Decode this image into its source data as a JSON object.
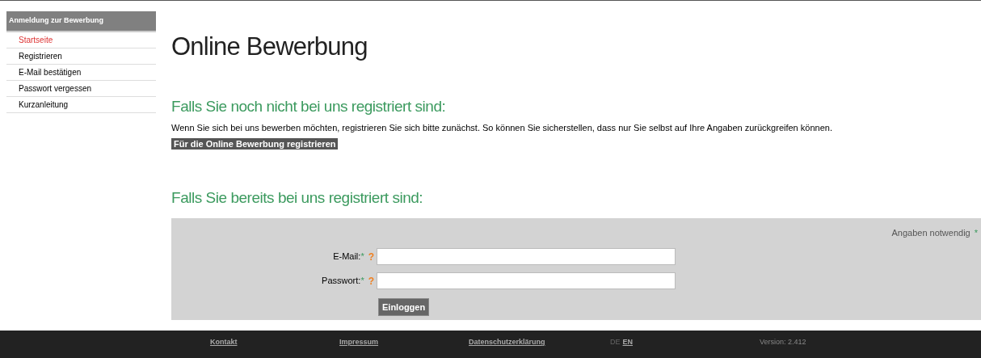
{
  "sidebar": {
    "title": "Anmeldung zur Bewerbung",
    "items": [
      {
        "label": "Startseite",
        "selected": true
      },
      {
        "label": "Registrieren",
        "selected": false
      },
      {
        "label": "E-Mail bestätigen",
        "selected": false
      },
      {
        "label": "Passwort vergessen",
        "selected": false
      },
      {
        "label": "Kurzanleitung",
        "selected": false
      }
    ]
  },
  "title": "Online Bewerbung",
  "register": {
    "heading": "Falls Sie noch nicht bei uns registriert sind:",
    "text": "Wenn Sie sich bei uns bewerben möchten, registrieren Sie sich bitte zunächst. So können Sie sicherstellen, dass nur Sie selbst auf Ihre Angaben zurückgreifen können.",
    "button": "Für die Online Bewerbung registrieren"
  },
  "login": {
    "heading": "Falls Sie bereits bei uns registriert sind:",
    "required_note": "Angaben notwendig",
    "required_mark": "*",
    "fields": [
      {
        "label": "E-Mail:",
        "required": "*",
        "help": "?"
      },
      {
        "label": "Passwort:",
        "required": "*",
        "help": "?"
      }
    ],
    "button": "Einloggen"
  },
  "footer": {
    "links": [
      "Kontakt",
      "Impressum",
      "Datenschutzerklärung"
    ],
    "languages": [
      {
        "label": "DE",
        "selected": true
      },
      {
        "label": "EN",
        "selected": false
      }
    ],
    "version": "Version: 2.412"
  }
}
